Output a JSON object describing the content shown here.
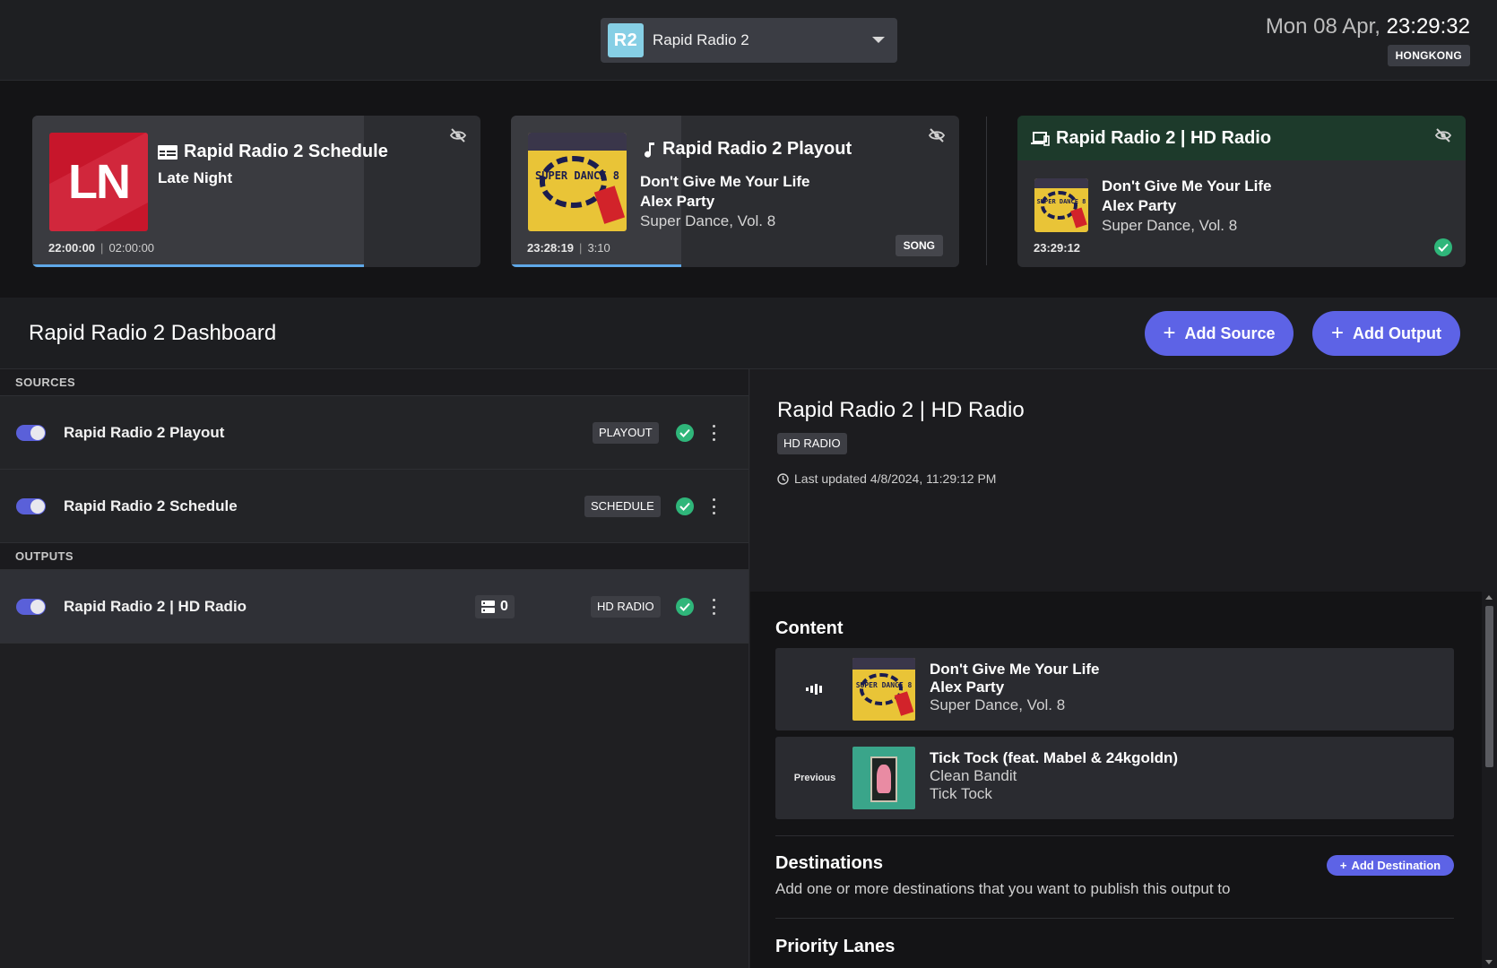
{
  "station": {
    "avatar": "R2",
    "name": "Rapid Radio 2"
  },
  "clock": {
    "date": "Mon 08 Apr,",
    "time": "23:29:32",
    "timezone": "HONGKONG"
  },
  "cards": {
    "schedule": {
      "art_text": "LN",
      "title": "Rapid Radio 2 Schedule",
      "subtitle": "Late Night",
      "start": "22:00:00",
      "end": "02:00:00",
      "progress": 0.74
    },
    "playout": {
      "title": "Rapid Radio 2 Playout",
      "song": "Don't Give Me Your Life",
      "artist": "Alex Party",
      "album": "Super Dance, Vol. 8",
      "start": "23:28:19",
      "duration": "3:10",
      "badge": "SONG",
      "progress": 0.38,
      "art_text": "SUPER DANCE 8"
    },
    "hd": {
      "title": "Rapid Radio 2 | HD Radio",
      "song": "Don't Give Me Your Life",
      "artist": "Alex Party",
      "album": "Super Dance, Vol. 8",
      "time": "23:29:12",
      "art_text": "SUPER DANCE 8"
    }
  },
  "dashboard": {
    "title": "Rapid Radio 2 Dashboard",
    "add_source": "Add Source",
    "add_output": "Add Output"
  },
  "sources": {
    "label": "SOURCES",
    "items": [
      {
        "name": "Rapid Radio 2 Playout",
        "type": "PLAYOUT"
      },
      {
        "name": "Rapid Radio 2 Schedule",
        "type": "SCHEDULE"
      }
    ]
  },
  "outputs": {
    "label": "OUTPUTS",
    "items": [
      {
        "name": "Rapid Radio 2 | HD Radio",
        "count": "0",
        "type": "HD RADIO"
      }
    ]
  },
  "detail": {
    "title": "Rapid Radio 2 | HD Radio",
    "badge": "HD RADIO",
    "updated": "Last updated 4/8/2024, 11:29:12 PM",
    "content_title": "Content",
    "tracks": [
      {
        "lead": "",
        "title": "Don't Give Me Your Life",
        "artist": "Alex Party",
        "album": "Super Dance, Vol. 8"
      },
      {
        "lead": "Previous",
        "title": "Tick Tock (feat. Mabel & 24kgoldn)",
        "artist": "Clean Bandit",
        "album": "Tick Tock"
      }
    ],
    "destinations_title": "Destinations",
    "destinations_desc": "Add one or more destinations that you want to publish this output to",
    "add_destination": "Add Destination",
    "priority_title": "Priority Lanes"
  },
  "colors": {
    "accent": "#5d63e6",
    "success": "#2fb67a",
    "hd_header": "#1d3a2b",
    "progress": "#5fa8e8"
  }
}
